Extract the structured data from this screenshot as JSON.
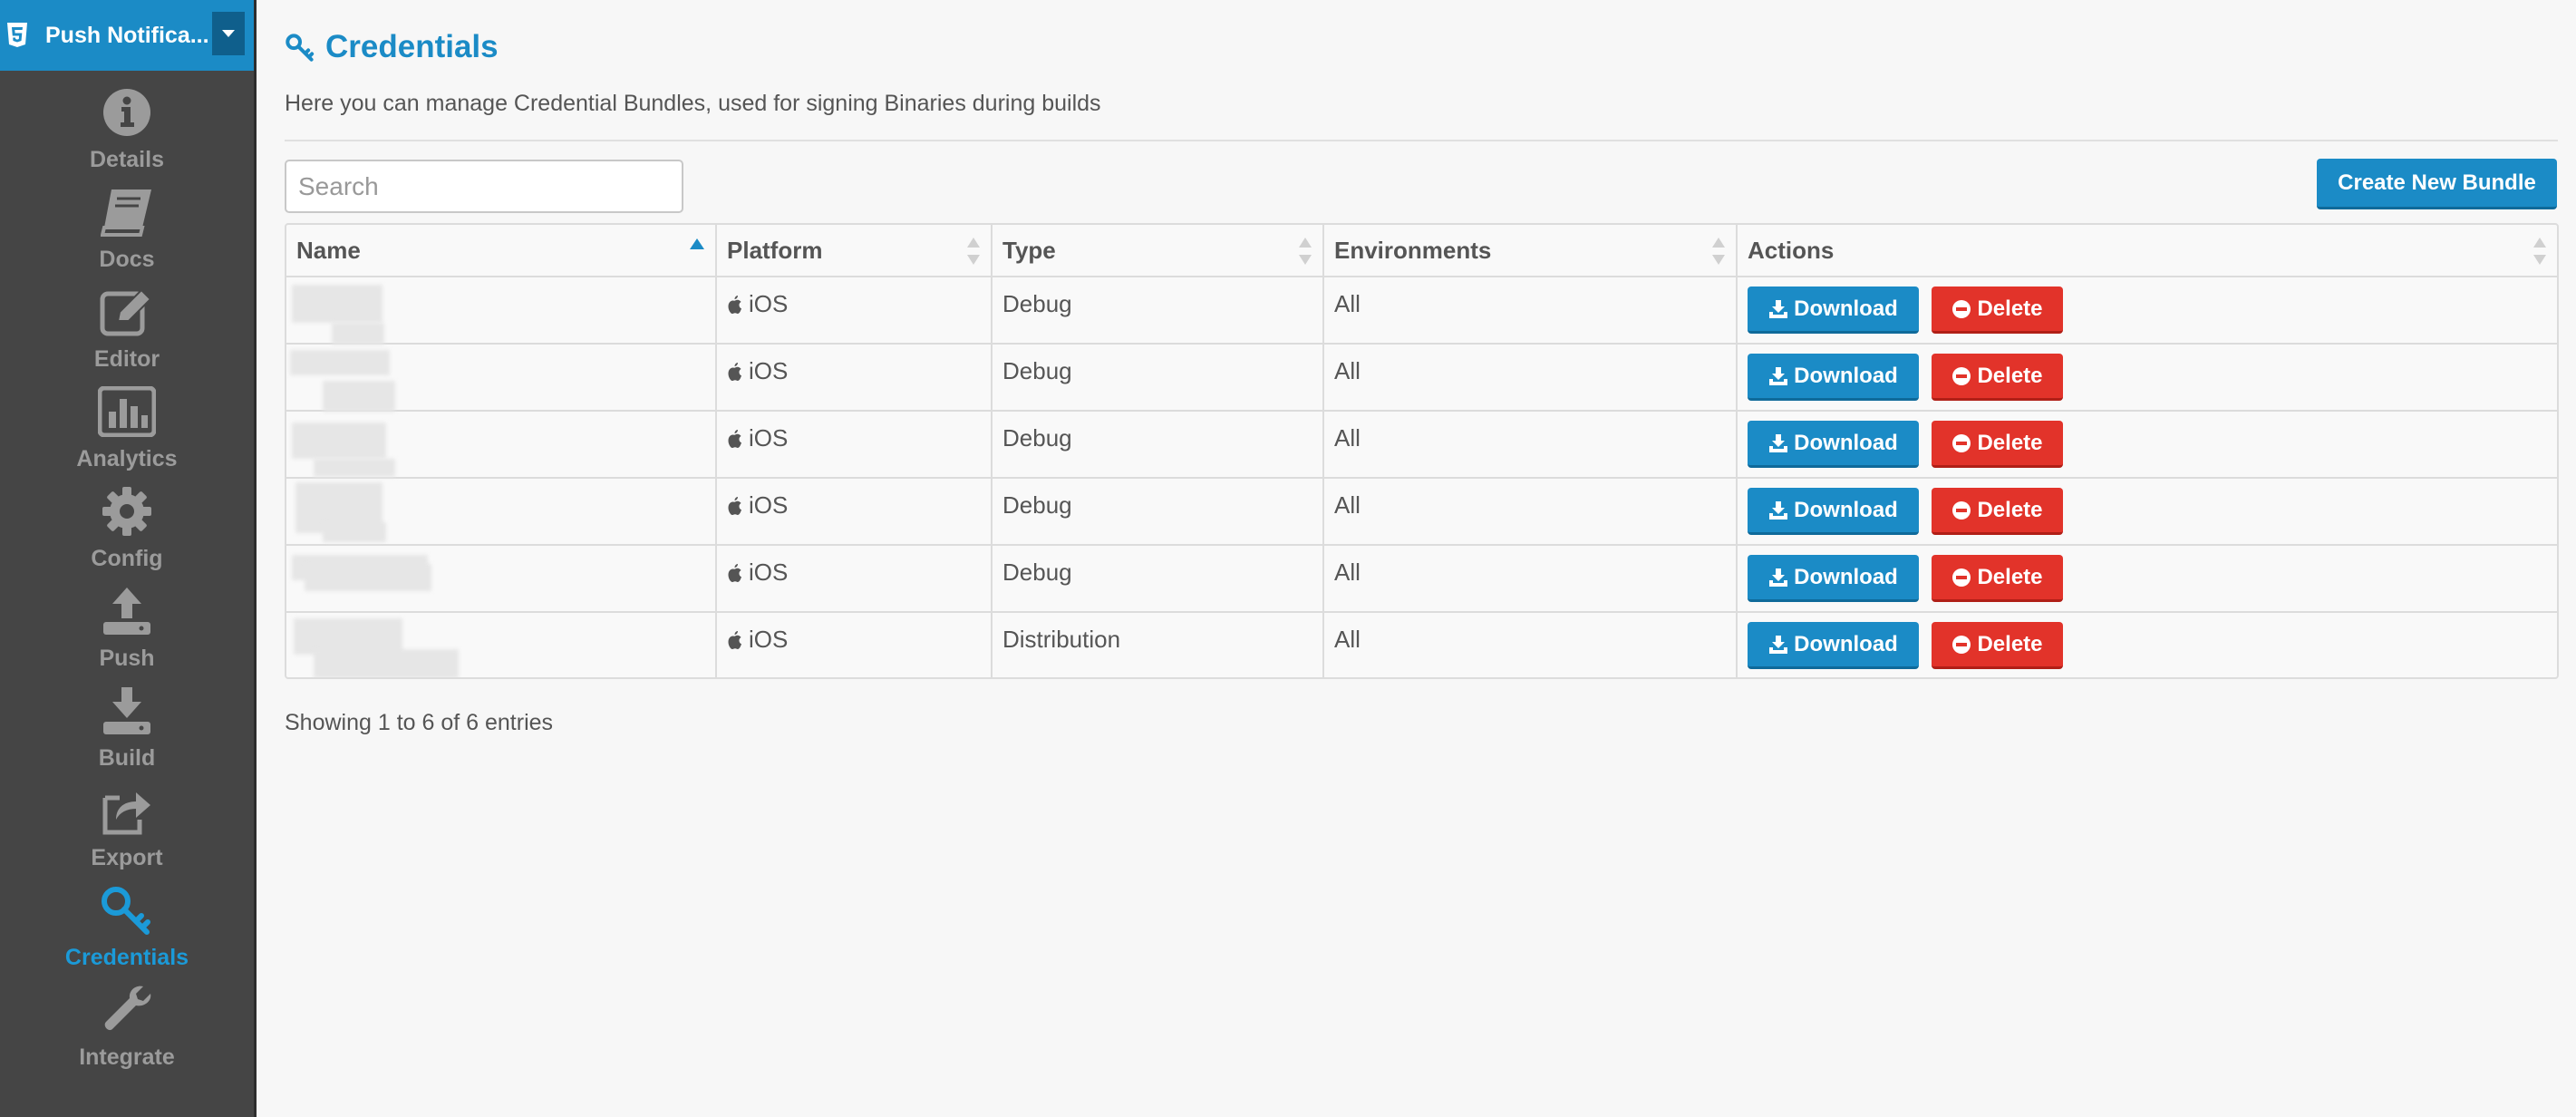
{
  "app": {
    "name": "Push Notifica...",
    "accent": "#1b8bc6",
    "danger": "#e2332a"
  },
  "sidebar": {
    "items": [
      {
        "label": "Details",
        "icon": "info-icon",
        "active": false
      },
      {
        "label": "Docs",
        "icon": "book-icon",
        "active": false
      },
      {
        "label": "Editor",
        "icon": "edit-icon",
        "active": false
      },
      {
        "label": "Analytics",
        "icon": "bar-chart-icon",
        "active": false
      },
      {
        "label": "Config",
        "icon": "gear-icon",
        "active": false
      },
      {
        "label": "Push",
        "icon": "upload-icon",
        "active": false
      },
      {
        "label": "Build",
        "icon": "download-icon",
        "active": false
      },
      {
        "label": "Export",
        "icon": "share-icon",
        "active": false
      },
      {
        "label": "Credentials",
        "icon": "key-icon",
        "active": true
      },
      {
        "label": "Integrate",
        "icon": "wrench-icon",
        "active": false
      }
    ]
  },
  "page": {
    "title": "Credentials",
    "subtitle": "Here you can manage Credential Bundles, used for signing Binaries during builds"
  },
  "search": {
    "placeholder": "Search",
    "value": ""
  },
  "create_button_label": "Create New Bundle",
  "table": {
    "columns": [
      "Name",
      "Platform",
      "Type",
      "Environments",
      "Actions"
    ],
    "sorted_column": "Name",
    "sort_direction": "ascending",
    "rows": [
      {
        "name": "",
        "platform": "iOS",
        "type": "Debug",
        "environments": "All"
      },
      {
        "name": "",
        "platform": "iOS",
        "type": "Debug",
        "environments": "All"
      },
      {
        "name": "",
        "platform": "iOS",
        "type": "Debug",
        "environments": "All"
      },
      {
        "name": "",
        "platform": "iOS",
        "type": "Debug",
        "environments": "All"
      },
      {
        "name": "",
        "platform": "iOS",
        "type": "Debug",
        "environments": "All"
      },
      {
        "name": "",
        "platform": "iOS",
        "type": "Distribution",
        "environments": "All"
      }
    ],
    "download_label": "Download",
    "delete_label": "Delete"
  },
  "entries_info": "Showing 1 to 6 of 6 entries"
}
